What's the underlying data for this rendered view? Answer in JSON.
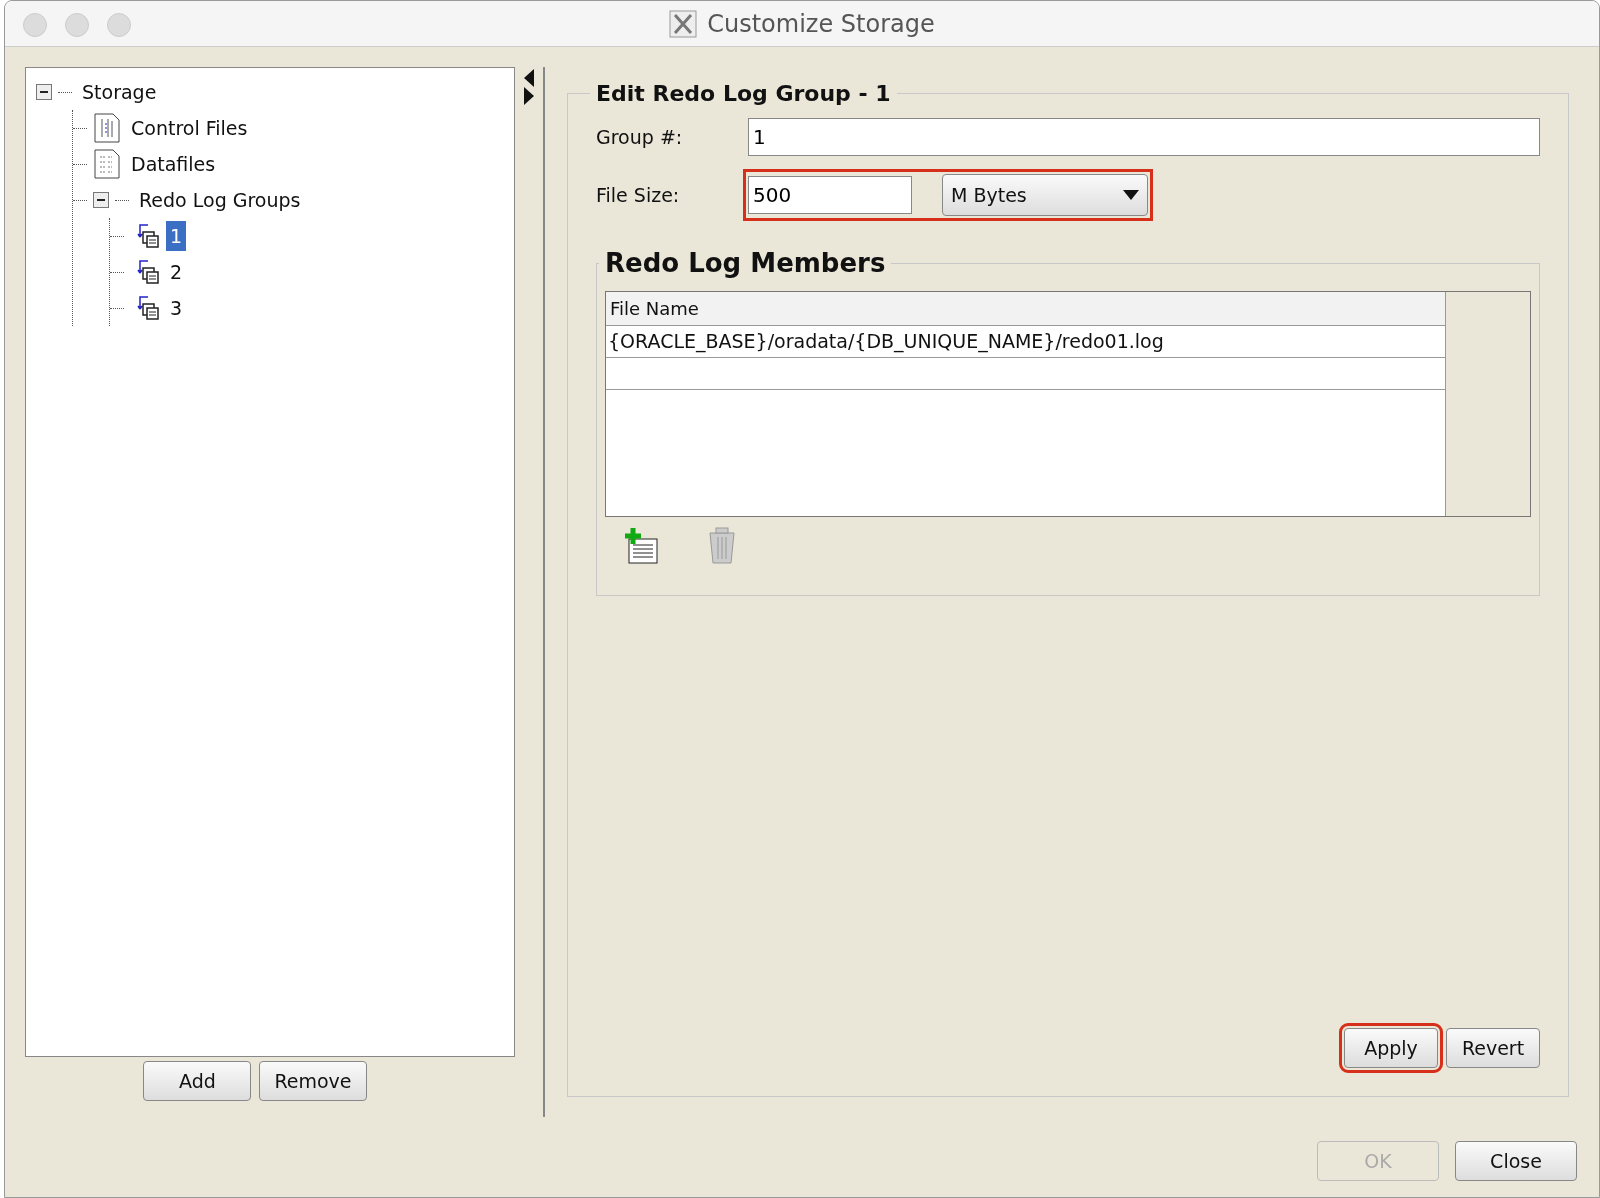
{
  "window": {
    "title": "Customize Storage"
  },
  "tree": [
    {
      "label": "Storage",
      "expanded": true,
      "selected": false,
      "children": [
        {
          "label": "Control Files",
          "kind": "control-files",
          "selected": false
        },
        {
          "label": "Datafiles",
          "kind": "datafiles",
          "selected": false
        },
        {
          "label": "Redo Log Groups",
          "expanded": true,
          "selected": false,
          "children": [
            {
              "label": "1",
              "kind": "redo-group",
              "selected": true
            },
            {
              "label": "2",
              "kind": "redo-group",
              "selected": false
            },
            {
              "label": "3",
              "kind": "redo-group",
              "selected": false
            }
          ]
        }
      ]
    }
  ],
  "tree_buttons": [
    {
      "label": "Add"
    },
    {
      "label": "Remove"
    }
  ],
  "editor": {
    "title": "Edit Redo Log Group - 1",
    "group": {
      "label": "Group #:",
      "value": "1"
    },
    "file_size": {
      "label": "File Size:",
      "value": "500",
      "unit": "M Bytes",
      "highlighted": true
    },
    "members": {
      "title": "Redo Log Members",
      "column": "File Name",
      "rows": [
        {
          "file_name": "{ORACLE_BASE}/oradata/{DB_UNIQUE_NAME}/redo01.log"
        },
        {
          "file_name": ""
        }
      ]
    },
    "buttons": [
      {
        "label": "Apply",
        "highlighted": true
      },
      {
        "label": "Revert",
        "highlighted": false
      }
    ]
  },
  "dialog_buttons": [
    {
      "label": "OK",
      "disabled": true
    },
    {
      "label": "Close",
      "disabled": false
    }
  ]
}
